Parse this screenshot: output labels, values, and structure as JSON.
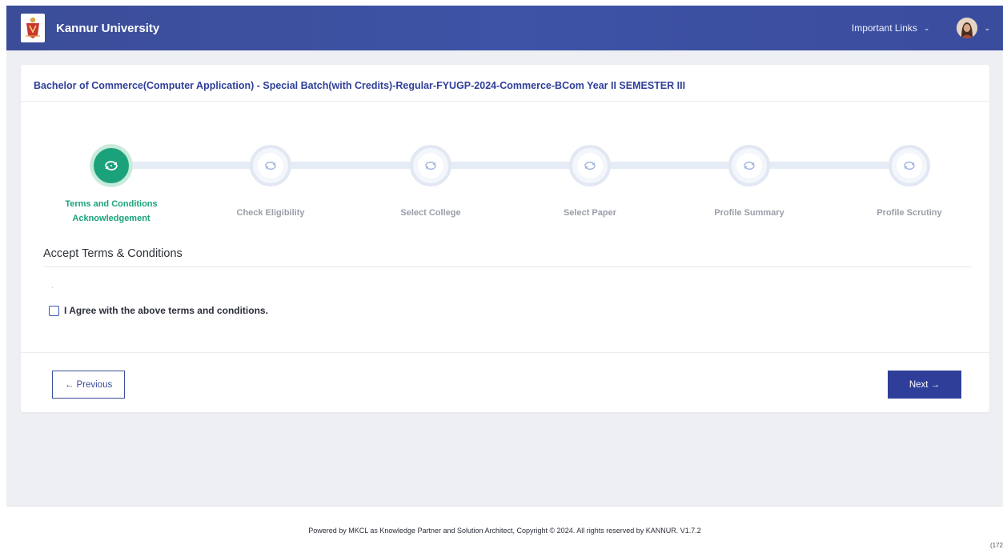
{
  "header": {
    "brand": "Kannur University",
    "important_links": "Important Links"
  },
  "course": {
    "title": "Bachelor of Commerce(Computer Application) - Special Batch(with Credits)-Regular-FYUGP-2024-Commerce-BCom Year II SEMESTER III"
  },
  "steps": [
    {
      "line1": "Terms and Conditions",
      "line2": "Acknowledgement",
      "active": true
    },
    {
      "line1": "Check Eligibility",
      "line2": "",
      "active": false
    },
    {
      "line1": "Select College",
      "line2": "",
      "active": false
    },
    {
      "line1": "Select Paper",
      "line2": "",
      "active": false
    },
    {
      "line1": "Profile Summary",
      "line2": "",
      "active": false
    },
    {
      "line1": "Profile Scrutiny",
      "line2": "",
      "active": false
    }
  ],
  "section": {
    "title": "Accept Terms & Conditions",
    "body": ".",
    "agree_label": "I Agree with the above terms and conditions."
  },
  "buttons": {
    "previous": "← Previous",
    "next": "Next →"
  },
  "footer": {
    "text": "Powered by MKCL as Knowledge Partner and Solution Architect, Copyright © 2024. All rights reserved by KANNUR. V1.7.2"
  },
  "corner_text": "(172",
  "colors": {
    "primary": "#2f3f99",
    "success": "#1ba27a",
    "muted": "#9a9ea8"
  }
}
